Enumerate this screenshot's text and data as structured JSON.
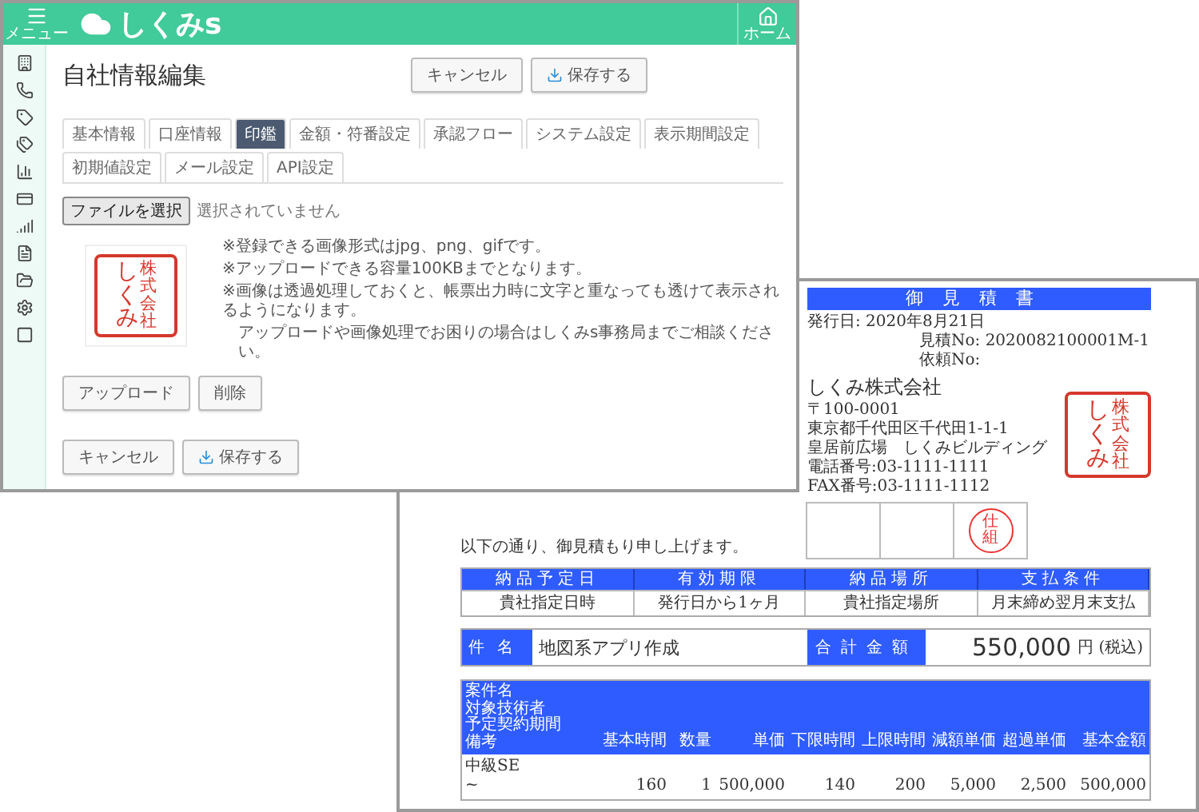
{
  "settings_window": {
    "menu_label": "メニュー",
    "logo": "しくみs",
    "home_label": "ホーム",
    "title": "自社情報編集",
    "header_buttons": [
      {
        "label": "キャンセル",
        "kind": "plain"
      },
      {
        "label": "保存する",
        "kind": "save"
      }
    ],
    "tabs": [
      {
        "label": "基本情報",
        "selected": false
      },
      {
        "label": "口座情報",
        "selected": false
      },
      {
        "label": "印鑑",
        "selected": true
      },
      {
        "label": "金額・符番設定",
        "selected": false
      },
      {
        "label": "承認フロー",
        "selected": false
      },
      {
        "label": "システム設定",
        "selected": false
      },
      {
        "label": "表示期間設定",
        "selected": false
      },
      {
        "label": "初期値設定",
        "selected": false
      },
      {
        "label": "メール設定",
        "selected": false
      },
      {
        "label": "API設定",
        "selected": false
      }
    ],
    "file_button": "ファイルを選択",
    "file_status": "選択されていません",
    "seal": {
      "columns": [
        "しくみ",
        "株式会社"
      ]
    },
    "notes": [
      "※登録できる画像形式はjpg、png、gifです。",
      "※アップロードできる容量100KBまでとなります。",
      "※画像は透過処理しておくと、帳票出力時に文字と重なっても透けて表示されるようになります。",
      "アップロードや画像処理でお困りの場合はしくみs事務局までご相談ください。"
    ],
    "image_buttons": [
      {
        "label": "アップロード",
        "kind": "plain"
      },
      {
        "label": "削除",
        "kind": "plain"
      }
    ],
    "footer_buttons": [
      {
        "label": "キャンセル",
        "kind": "plain"
      },
      {
        "label": "保存する",
        "kind": "save"
      }
    ]
  },
  "estimate_window": {
    "doc_title": "御見積書",
    "issue_date": "発行日: 2020年8月21日",
    "estimate_no": "見積No: 2020082100001M-1",
    "request_no": "依頼No:",
    "company": "しくみ株式会社",
    "address_lines": [
      "〒100-0001",
      "東京都千代田区千代田1-1-1",
      "皇居前広場　しくみビルディング",
      "電話番号:03-1111-1111",
      "FAX番号:03-1111-1112"
    ],
    "seal": {
      "columns": [
        "しくみ",
        "株式会社"
      ]
    },
    "approval_cells": [
      {
        "stamped": false
      },
      {
        "stamped": false
      },
      {
        "stamped": true,
        "stamp": "仕組"
      }
    ],
    "intro": "以下の通り、御見積もり申し上げます。",
    "conditions": {
      "headers": [
        "納品予定日",
        "有効期限",
        "納品場所",
        "支払条件"
      ],
      "values": [
        "貴社指定日時",
        "発行日から1ヶ月",
        "貴社指定場所",
        "月末締め翌月末支払"
      ]
    },
    "subject_label": "件名",
    "subject": "地図系アプリ作成",
    "total_label": "合計金額",
    "total_amount": "550,000",
    "total_suffix": "円 (税込)",
    "detail_table": {
      "name_headers": [
        "案件名",
        "対象技術者",
        "予定契約期間",
        "備考"
      ],
      "columns": [
        "基本時間",
        "数量",
        "単価",
        "下限時間",
        "上限時間",
        "減額単価",
        "超過単価",
        "基本金額"
      ],
      "rows": [
        {
          "name_lines": [
            "中級SE",
            "~"
          ],
          "values": [
            "160",
            "1",
            "500,000",
            "140",
            "200",
            "5,000",
            "2,500",
            "500,000"
          ]
        }
      ]
    }
  }
}
